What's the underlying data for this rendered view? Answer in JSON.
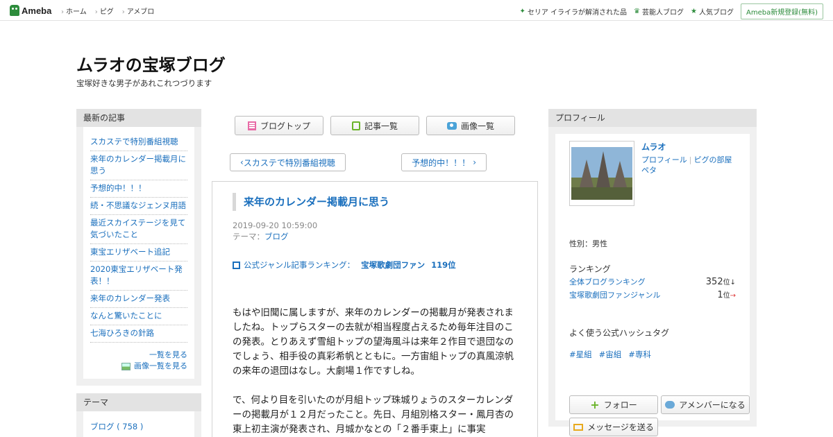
{
  "topbar": {
    "logo": "Ameba",
    "nav": [
      "ホーム",
      "ピグ",
      "アメブロ"
    ],
    "right_links": [
      "セリア イライラが解消された品",
      "芸能人ブログ",
      "人気ブログ"
    ],
    "signup": "Ameba新規登録(無料)"
  },
  "header": {
    "title": "ムラオの宝塚ブログ",
    "description": "宝塚好きな男子があれこれつづります"
  },
  "left": {
    "latest_heading": "最新の記事",
    "articles": [
      "スカステで特別番組視聴",
      "来年のカレンダー掲載月に思う",
      "予想的中！！！",
      "続・不思議なジェンヌ用語",
      "最近スカイステージを見て気づいたこと",
      "東宝エリザベート追記",
      "2020東宝エリザベート発表！！",
      "来年のカレンダー発表",
      "なんと驚いたことに",
      "七海ひろきの針路"
    ],
    "more_list": "一覧を見る",
    "more_images": "画像一覧を見る",
    "theme_heading": "テーマ",
    "theme_item": "ブログ ( 758 )"
  },
  "center": {
    "buttons": [
      "ブログトップ",
      "記事一覧",
      "画像一覧"
    ],
    "prev": "スカステで特別番組視聴",
    "next": "予想的中！！！",
    "article": {
      "title": "来年のカレンダー掲載月に思う",
      "date": "2019-09-20 10:59:00",
      "theme_label": "テーマ：",
      "theme": "ブログ",
      "ranking_label": "公式ジャンル記事ランキング：",
      "ranking_genre": "宝塚歌劇団ファン",
      "ranking_rank": "119位",
      "paragraph1": "もはや旧聞に属しますが、来年のカレンダーの掲載月が発表されましたね。トップらスターの去就が相当程度占えるため毎年注目のこの発表。とりあえず雪組トップの望海風斗は来年２作目で退団なのでしょう、相手役の真彩希帆とともに。一方宙組トップの真風涼帆の来年の退団はなし。大劇場１作ですしね。",
      "paragraph2": "で、何より目を引いたのが月組トップ珠城りょうのスターカレンダーの掲載月が１２月だったこと。先日、月組別格スター・鳳月杏の東上初主演が発表され、月城かなとの「２番手東上」に事実"
    }
  },
  "right": {
    "heading": "プロフィール",
    "name": "ムラオ",
    "link_profile": "プロフィール",
    "link_room": "ピグの部屋",
    "link_peta": "ペタ",
    "gender": "性別：男性",
    "ranking_heading": "ランキング",
    "rank1_label": "全体ブログランキング",
    "rank1_value": "352",
    "rank1_unit": "位",
    "rank1_trend": "↓",
    "rank2_label": "宝塚歌劇団ファンジャンル",
    "rank2_value": "1",
    "rank2_unit": "位",
    "rank2_trend": "→",
    "tags_heading": "よく使う公式ハッシュタグ",
    "tags": [
      "#星組",
      "#宙組",
      "#専科"
    ],
    "btn_follow": "フォロー",
    "btn_member": "アメンバーになる",
    "btn_message": "メッセージを送る"
  },
  "colors": {
    "accent": "#1a6fbd",
    "brand": "#2d8c3c",
    "panel": "#e3e3e3"
  }
}
